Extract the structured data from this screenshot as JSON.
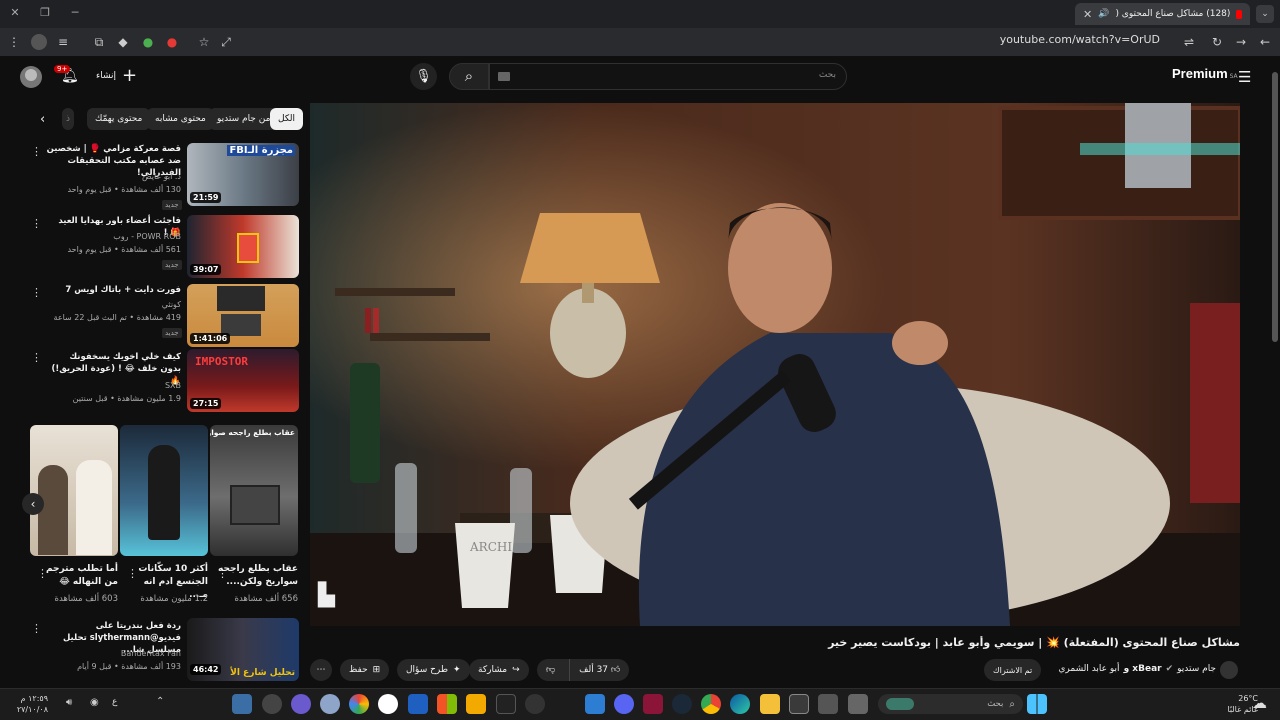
{
  "browser": {
    "tab_title": "(128) مشاكل صناع المحتوى (",
    "url": "youtube.com/watch?v=OrUD"
  },
  "header": {
    "search_placeholder": "بحث",
    "create_label": "إنشاء",
    "notif_count": "9+",
    "logo_text": "Premium",
    "region": "SA"
  },
  "chips": [
    "الكل",
    "من جام ستديو",
    "محتوى مشابه",
    "محتوى يهمّك",
    "ذ"
  ],
  "recommendations": [
    {
      "title": "قصة معركة مزامي 🥊 | شخصين ضد عصابه مكتب التحقيقات الفيدرالي!",
      "channel": "د. أبو عايض",
      "meta": "130 ألف مشاهدة • قبل يوم واحد",
      "badge": "جديد",
      "duration": "21:59",
      "thumb_text": "مجزرة الـFBI"
    },
    {
      "title": "فاجئت أعضاء باور بهدايا العيد 🎁 !",
      "channel": "POWR ROB - روب",
      "meta": "561 ألف مشاهدة • قبل يوم واحد",
      "badge": "جديد",
      "duration": "39:07",
      "thumb_text": ""
    },
    {
      "title": "فورت دايت + باتاك اويس 7",
      "channel": "كونثي",
      "meta": "419 مشاهدة • تم البث قبل 22 ساعة",
      "badge": "جديد",
      "duration": "1:41:06",
      "thumb_text": ""
    },
    {
      "title": "كيف خلي اخويك يسخفونك بدون خلف 😂 ! (عودة الحريق!) 🔥",
      "channel": "SXB",
      "meta": "1.9 مليون مشاهدة • قبل سنتين",
      "badge": "",
      "duration": "27:15",
      "thumb_text": "IMPOSTOR"
    }
  ],
  "shorts": [
    {
      "title": "عقاب بطلع راجحه سواريخ ولكن....",
      "meta": "656 ألف مشاهدة",
      "overlay": "عقاب بطلع راجحه صواريخ 🔥"
    },
    {
      "title": "أكثر 10 سكّانات الجنسع ادم انه مـ...",
      "meta": "1.2 مليون مشاهدة",
      "overlay": ""
    },
    {
      "title": "أما تطلب مترجم من النهاله 😂",
      "meta": "603 ألف مشاهدة",
      "overlay": ""
    }
  ],
  "last_rec": {
    "title": "ردة فعل بندريتا على فيديو@slythermann تحليل مسلسل شا...",
    "channel": "Banderitax Fan",
    "meta": "193 ألف مشاهدة • قبل 9 أيام",
    "duration": "46:42",
    "thumb_text": "تحليل شارع الأ"
  },
  "video": {
    "title": "مشاكل صناع المحتوى (المفتعلة) 💥 | سويمي وأبو عابد | بودكاست يصير خير",
    "channel": "جام ستديو",
    "channel2": "xBear و",
    "channel3": "أبو عابد الشمري",
    "subscribed_label": "تم الاشتراك",
    "likes": "37 ألف",
    "share_label": "مشاركة",
    "ask_label": "طرح سؤال",
    "save_label": "حفظ",
    "lamp_cup_text": "ARCHI"
  },
  "taskbar": {
    "weather_temp": "26°C",
    "weather_desc": "غائم غالبًا",
    "search_label": "بحث",
    "time": "١٢:٥٩ م",
    "date": "٢٧/١٠/٠٨",
    "lang": "ع"
  },
  "colors": {
    "youtube_red": "#ff0000",
    "bg": "#0f0f0f",
    "chip_bg": "#272727"
  }
}
